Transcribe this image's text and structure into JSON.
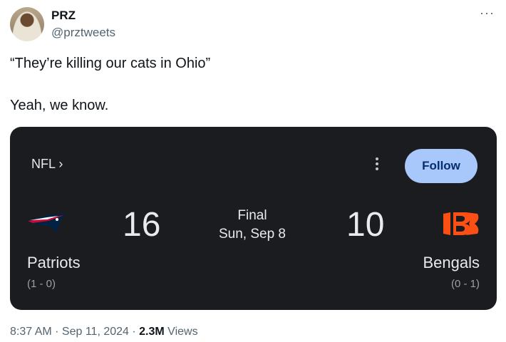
{
  "author": {
    "display_name": "PRZ",
    "handle": "@przt​weets"
  },
  "tweet": {
    "line1": "“They’re killing our cats in Ohio”",
    "line2": "Yeah, we know."
  },
  "more_icon": "···",
  "card": {
    "league_link": "NFL ›",
    "follow_label": "Follow",
    "status_line1": "Final",
    "status_line2": "Sun, Sep 8",
    "home": {
      "name": "Patriots",
      "record": "(1 - 0)",
      "score": "16",
      "logo": "patriots-logo"
    },
    "away": {
      "name": "Bengals",
      "record": "(0 - 1)",
      "score": "10",
      "logo": "bengals-logo"
    }
  },
  "meta": {
    "time": "8:37 AM",
    "dot1": " · ",
    "date": "Sep 11, 2024",
    "dot2": " · ",
    "views_count": "2.3M",
    "views_label": " Views"
  },
  "colors": {
    "card_bg": "#1b1c20",
    "follow_bg": "#a8c7fa",
    "bengals_orange": "#fb4f14",
    "patriots_navy": "#002244",
    "patriots_red": "#c60c30"
  }
}
